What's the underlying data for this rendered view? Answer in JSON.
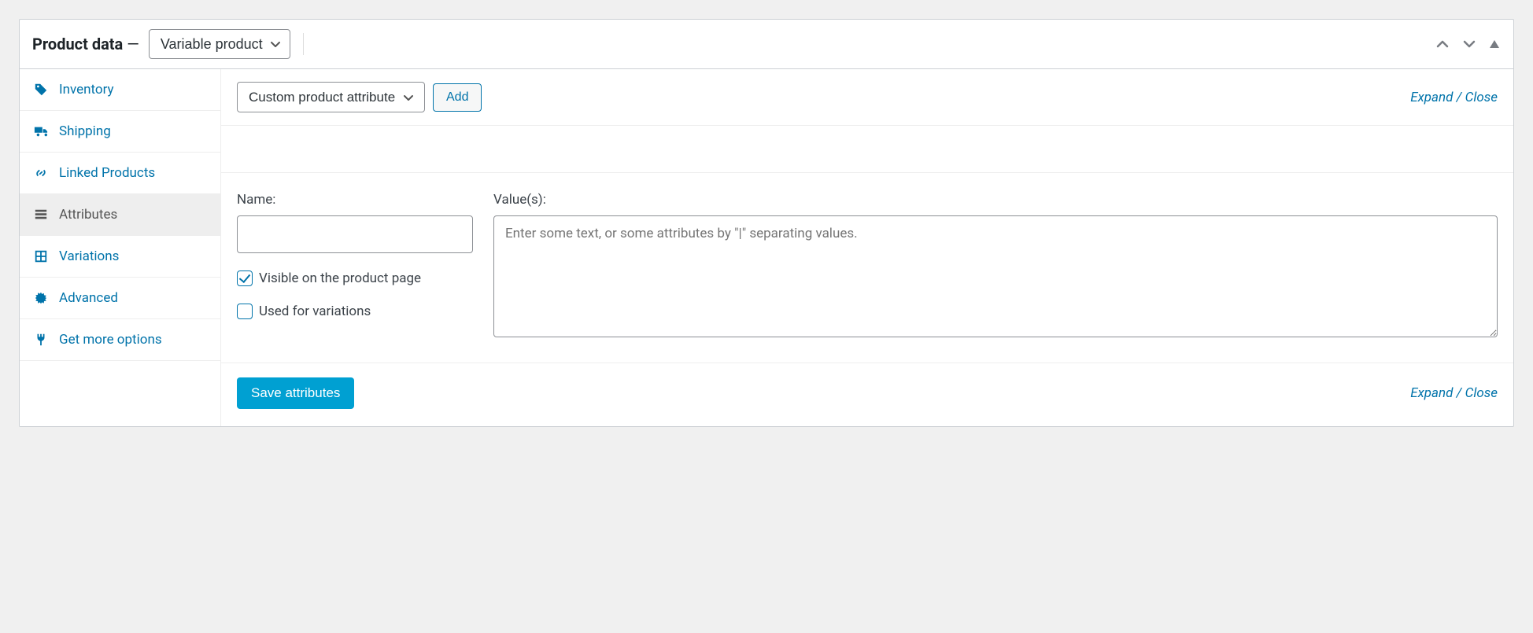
{
  "header": {
    "title_prefix": "Product data",
    "dash": "—",
    "product_type_selected": "Variable product"
  },
  "sidebar": {
    "items": [
      {
        "label": "Inventory"
      },
      {
        "label": "Shipping"
      },
      {
        "label": "Linked Products"
      },
      {
        "label": "Attributes"
      },
      {
        "label": "Variations"
      },
      {
        "label": "Advanced"
      },
      {
        "label": "Get more options"
      }
    ]
  },
  "toolbar": {
    "attribute_type_selected": "Custom product attribute",
    "add_label": "Add",
    "expand_label": "Expand",
    "close_label": "Close",
    "separator": " / "
  },
  "attribute": {
    "name_label": "Name:",
    "name_value": "",
    "values_label": "Value(s):",
    "values_placeholder": "Enter some text, or some attributes by \"|\" separating values.",
    "values_value": "",
    "visible_label": "Visible on the product page",
    "visible_checked": true,
    "used_for_variations_label": "Used for variations",
    "used_for_variations_checked": false
  },
  "footer": {
    "save_label": "Save attributes",
    "expand_label": "Expand",
    "close_label": "Close",
    "separator": " / "
  }
}
